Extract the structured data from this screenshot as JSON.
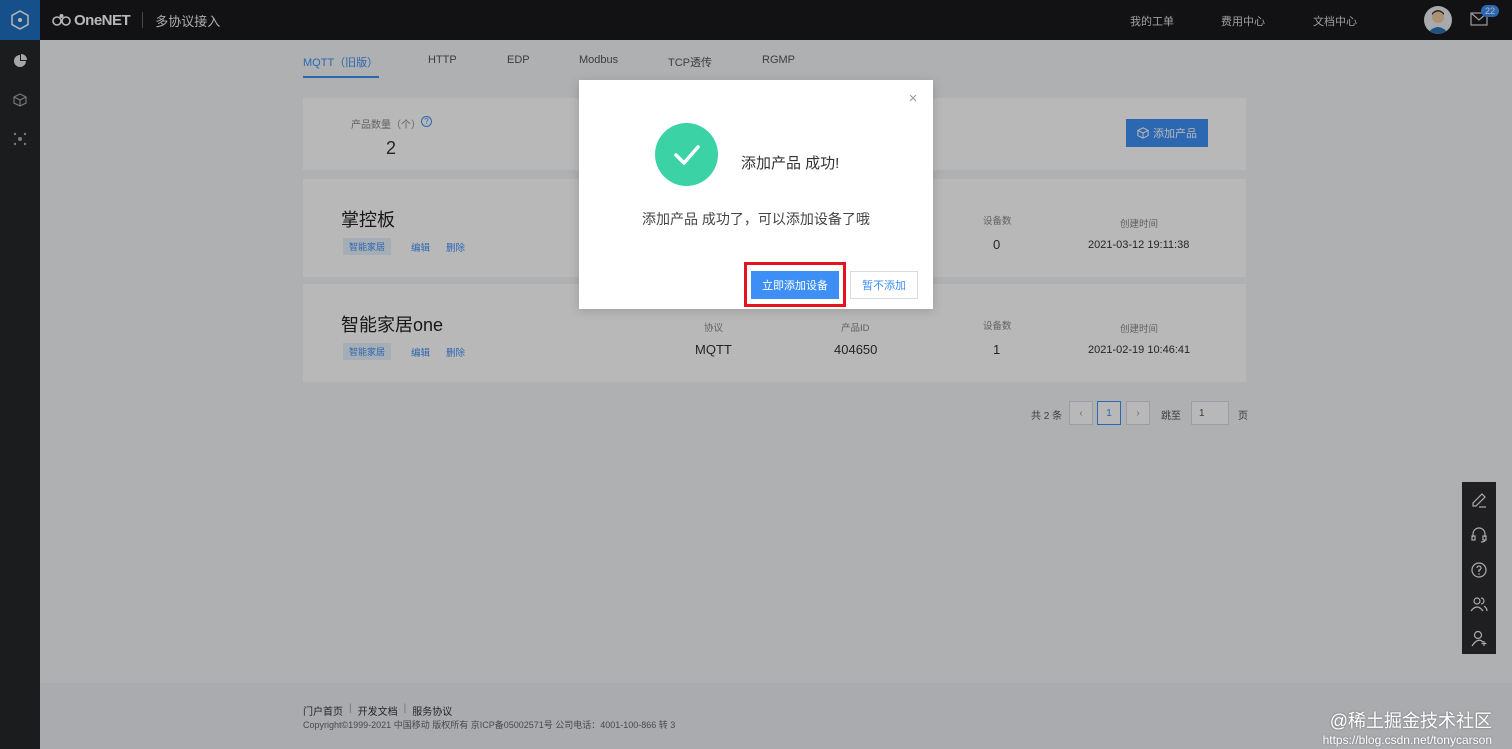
{
  "header": {
    "brand": "OneNET",
    "section": "多协议接入",
    "links": [
      "我的工单",
      "费用中心",
      "文档中心"
    ],
    "mail_badge": "22"
  },
  "sidebar": {
    "icons": [
      "hexagon-logo-icon",
      "pie-chart-icon",
      "cube-icon",
      "network-icon"
    ]
  },
  "tabs": [
    "MQTT（旧版）",
    "HTTP",
    "EDP",
    "Modbus",
    "TCP透传",
    "RGMP"
  ],
  "active_tab": "MQTT（旧版）",
  "summary": {
    "label": "产品数量（个）",
    "help": "?",
    "value": "2",
    "add_button": "添加产品"
  },
  "products": [
    {
      "name": "掌控板",
      "tag": "智能家居",
      "edit": "编辑",
      "delete": "删除",
      "device_count_label": "设备数",
      "device_count": "0",
      "created_label": "创建时间",
      "created": "2021-03-12 19:11:38"
    },
    {
      "name": "智能家居one",
      "tag": "智能家居",
      "edit": "编辑",
      "delete": "删除",
      "protocol_label": "协议",
      "protocol": "MQTT",
      "product_id_label": "产品ID",
      "product_id": "404650",
      "device_count_label": "设备数",
      "device_count": "1",
      "created_label": "创建时间",
      "created": "2021-02-19 10:46:41"
    }
  ],
  "pagination": {
    "total": "共 2 条",
    "prev": "‹",
    "current": "1",
    "next": "›",
    "jump_label": "跳至",
    "jump_value": "1",
    "page_suffix": "页"
  },
  "footer": {
    "links": [
      "门户首页",
      "开发文档",
      "服务协议"
    ],
    "separator": "|",
    "copyright": "Copyright©1999-2021 中国移动 版权所有 京ICP备05002571号 公司电话：4001-100-866 转 3"
  },
  "float_toolbar": [
    "edit-icon",
    "headset-icon",
    "question-icon",
    "users-icon",
    "add-user-icon"
  ],
  "modal": {
    "title": "添加产品 成功!",
    "description": "添加产品 成功了，可以添加设备了哦",
    "primary_button": "立即添加设备",
    "secondary_button": "暂不添加",
    "close": "×"
  },
  "watermark": {
    "line1": "@稀土掘金技术社区",
    "line2": "https://blog.csdn.net/tonycarson"
  },
  "colors": {
    "accent": "#3d8ff5",
    "success": "#3bd3a5",
    "highlight": "#e4141e",
    "topbar": "#1a1a1c"
  }
}
